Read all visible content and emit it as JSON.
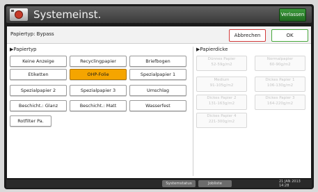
{
  "titlebar": {
    "title": "Systemeinst.",
    "exit_label": "Verlassen"
  },
  "header": {
    "title": "Papiertyp: Bypass",
    "cancel_label": "Abbrechen",
    "ok_label": "OK"
  },
  "paper_type": {
    "section_label": "▶Papiertyp",
    "buttons": [
      {
        "label": "Keine Anzeige",
        "state": "normal"
      },
      {
        "label": "Recyclingpapier",
        "state": "normal"
      },
      {
        "label": "Briefbogen",
        "state": "normal"
      },
      {
        "label": "Etiketten",
        "state": "normal"
      },
      {
        "label": "OHP-Folie",
        "state": "selected"
      },
      {
        "label": "Spezialpapier 1",
        "state": "normal"
      },
      {
        "label": "Spezialpapier 2",
        "state": "normal"
      },
      {
        "label": "Spezialpapier 3",
        "state": "normal"
      },
      {
        "label": "Umschlag",
        "state": "normal"
      },
      {
        "label": "Beschicht.: Glanz",
        "state": "normal"
      },
      {
        "label": "Beschicht.: Matt",
        "state": "normal"
      },
      {
        "label": "Wasserfest",
        "state": "normal"
      },
      {
        "label": "Rotfilter Pa.",
        "state": "normal"
      }
    ]
  },
  "paper_thickness": {
    "section_label": "▶Papierdicke",
    "buttons": [
      {
        "line1": "Dünnes Papier",
        "line2": "52-59g/m2"
      },
      {
        "line1": "Normalpapier",
        "line2": "60-90g/m2"
      },
      {
        "line1": "Medium",
        "line2": "91-105g/m2"
      },
      {
        "line1": "Dickes Papier 1",
        "line2": "106-130g/m2"
      },
      {
        "line1": "Dickes Papier 2",
        "line2": "131-163g/m2"
      },
      {
        "line1": "Dickes Papier 3",
        "line2": "164-220g/m2"
      },
      {
        "line1": "Dickes Papier 4",
        "line2": "221-300g/m2"
      }
    ]
  },
  "statusbar": {
    "btn1_label": "Systemstatus",
    "btn2_label": "Jobliste",
    "clock_line1": "21 JAN 2013",
    "clock_line2": "14:28"
  },
  "colors": {
    "selected": "#f5a500",
    "ok_border": "#47a83c",
    "cancel_border": "#d23a3a",
    "exit_button": "#2f8a2f"
  }
}
